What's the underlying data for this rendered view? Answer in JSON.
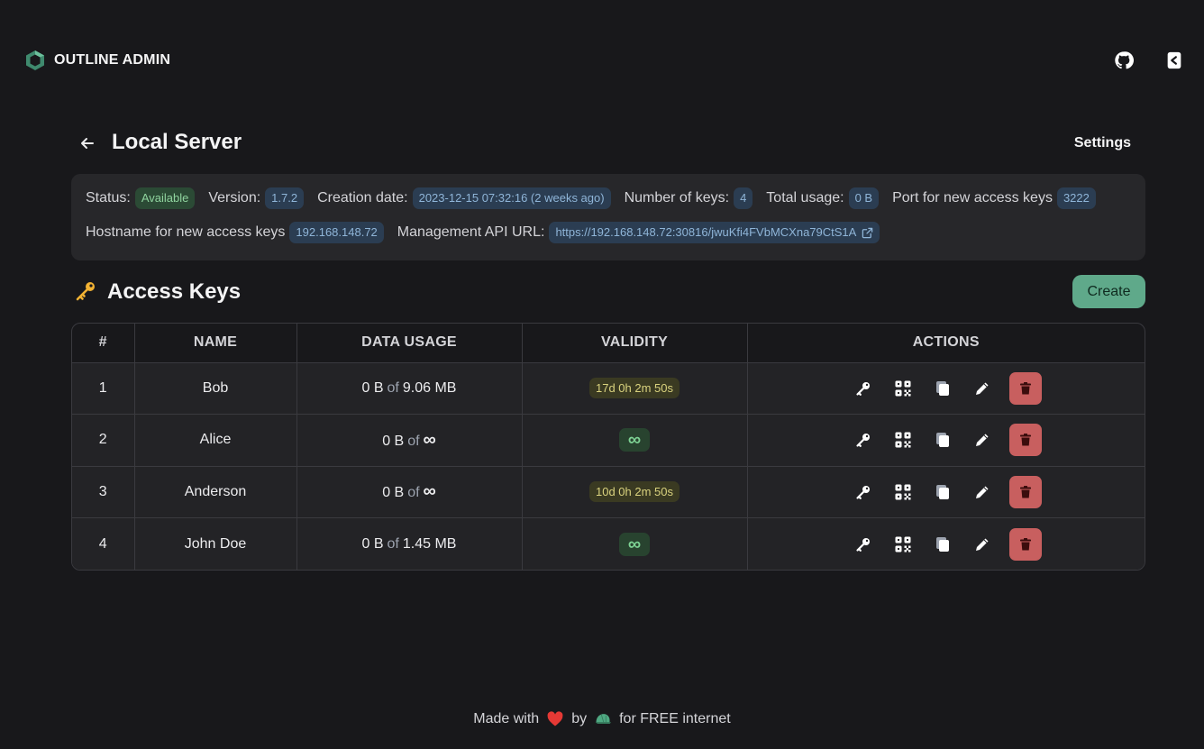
{
  "app": {
    "name": "OUTLINE ADMIN"
  },
  "header": {
    "title": "Local Server",
    "settings_label": "Settings"
  },
  "info": {
    "status_label": "Status:",
    "status_value": "Available",
    "version_label": "Version:",
    "version_value": "1.7.2",
    "creation_label": "Creation date:",
    "creation_value": "2023-12-15 07:32:16 (2 weeks ago)",
    "keys_label": "Number of keys:",
    "keys_value": "4",
    "usage_label": "Total usage:",
    "usage_value": "0 B",
    "port_label": "Port for new access keys",
    "port_value": "3222",
    "hostname_label": "Hostname for new access keys",
    "hostname_value": "192.168.148.72",
    "api_label": "Management API URL:",
    "api_value": "https://192.168.148.72:30816/jwuKfi4FVbMCXna79CtS1A"
  },
  "keys": {
    "title": "Access Keys",
    "create_label": "Create",
    "columns": [
      "#",
      "NAME",
      "DATA USAGE",
      "VALIDITY",
      "ACTIONS"
    ],
    "rows": [
      {
        "num": "1",
        "name": "Bob",
        "used": "0 B",
        "of": "of",
        "limit": "9.06 MB",
        "validity": "17d 0h 2m 50s"
      },
      {
        "num": "2",
        "name": "Alice",
        "used": "0 B",
        "of": "of",
        "limit": "∞",
        "validity": "∞"
      },
      {
        "num": "3",
        "name": "Anderson",
        "used": "0 B",
        "of": "of",
        "limit": "∞",
        "validity": "10d 0h 2m 50s"
      },
      {
        "num": "4",
        "name": "John Doe",
        "used": "0 B",
        "of": "of",
        "limit": "1.45 MB",
        "validity": "∞"
      }
    ]
  },
  "footer": {
    "made_with": "Made with",
    "by": "by",
    "tail": "for FREE internet"
  },
  "colors": {
    "background": "#18181b",
    "card": "#27272a",
    "accent": "#5fa98a",
    "danger": "#c85f5f",
    "chip": "#2b3d52"
  }
}
